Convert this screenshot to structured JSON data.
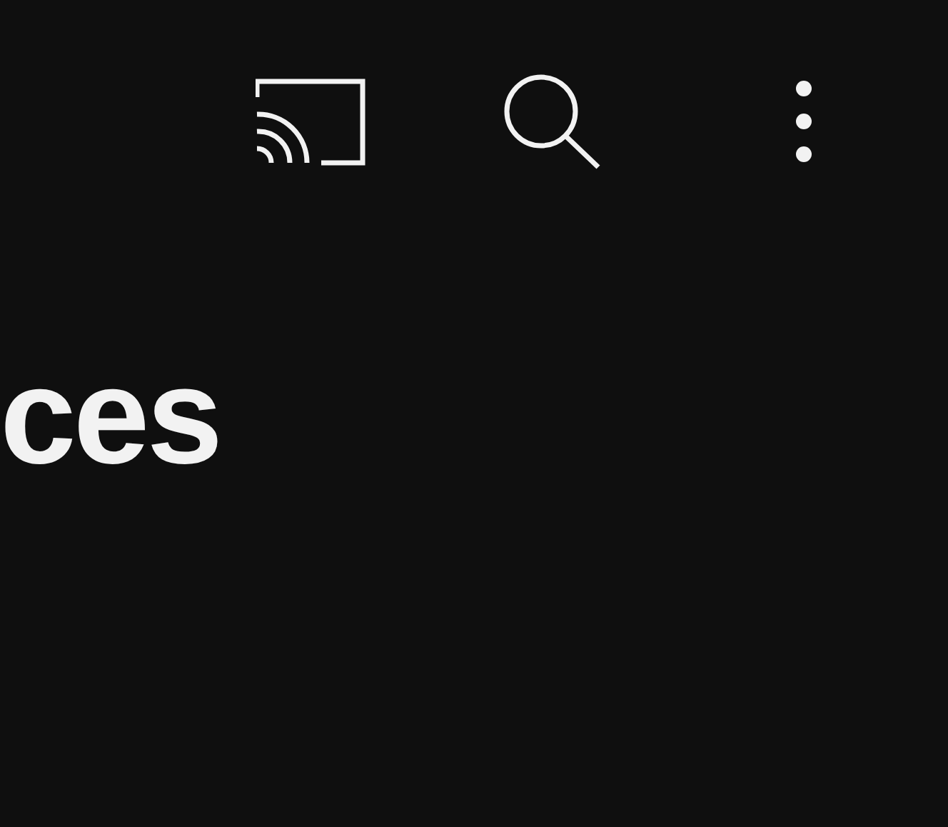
{
  "title": "ces"
}
